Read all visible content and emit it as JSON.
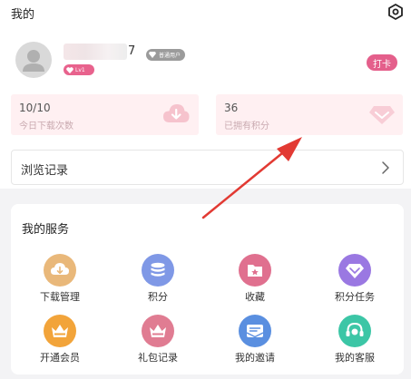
{
  "header": {
    "title": "我的",
    "settings_icon": "settings-hex-icon"
  },
  "profile": {
    "username_visible_suffix": "7",
    "member_badge": "普通用户",
    "level_badge": "Lv1",
    "checkin_label": "打卡"
  },
  "stats": [
    {
      "value": "10/10",
      "label": "今日下载次数",
      "icon": "download-cloud-icon"
    },
    {
      "value": "36",
      "label": "已拥有积分",
      "icon": "diamond-icon"
    }
  ],
  "history": {
    "label": "浏览记录"
  },
  "services": {
    "title": "我的服务",
    "items": [
      {
        "label": "下载管理",
        "icon": "download-manage-icon",
        "color": "#e9b87a"
      },
      {
        "label": "积分",
        "icon": "points-coins-icon",
        "color": "#7f98e6"
      },
      {
        "label": "收藏",
        "icon": "favorite-folder-icon",
        "color": "#e0708f"
      },
      {
        "label": "积分任务",
        "icon": "points-task-diamond-icon",
        "color": "#9a78e2"
      },
      {
        "label": "开通会员",
        "icon": "vip-crown-icon",
        "color": "#f2a43a"
      },
      {
        "label": "礼包记录",
        "icon": "gift-crown-icon",
        "color": "#e07c92"
      },
      {
        "label": "我的邀请",
        "icon": "invite-mail-icon",
        "color": "#5a8fe0"
      },
      {
        "label": "我的客服",
        "icon": "customer-service-icon",
        "color": "#3cc6a6"
      }
    ]
  },
  "colors": {
    "accent_pink": "#e45f8b",
    "stat_card_bg": "#fff0f2",
    "annotation_arrow": "#e23a33"
  }
}
